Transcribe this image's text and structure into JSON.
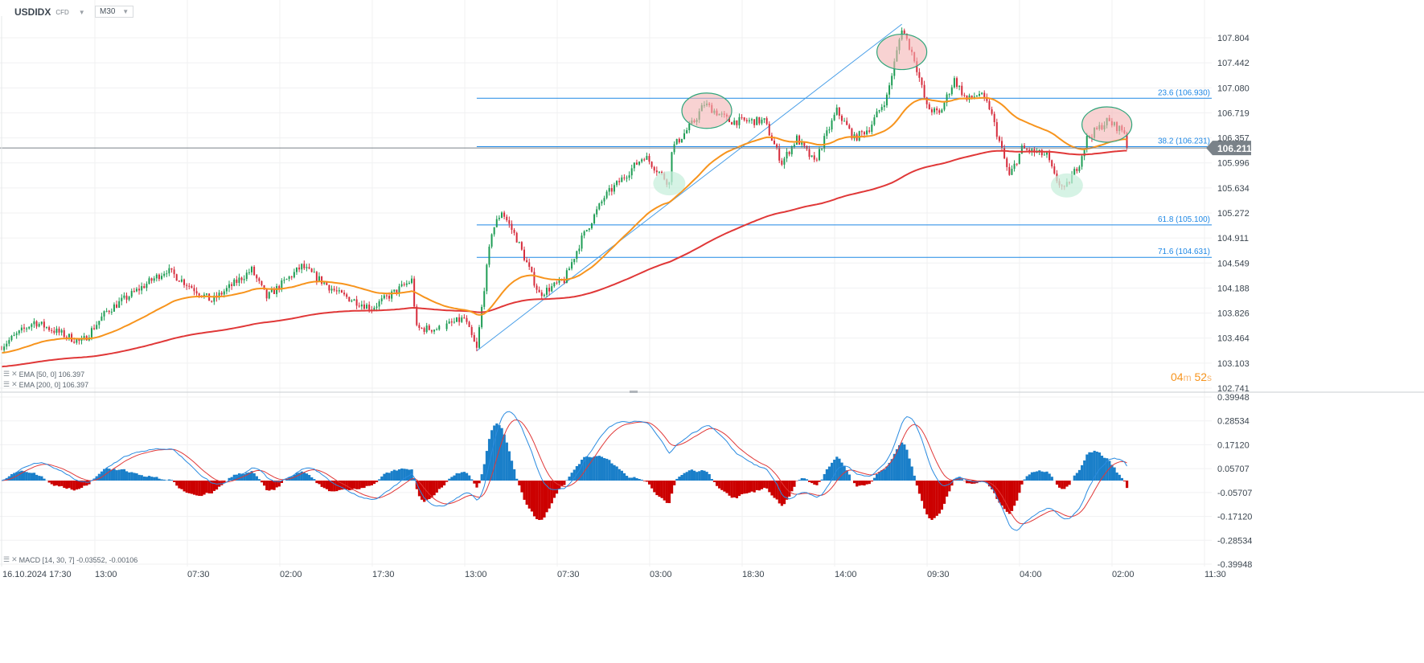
{
  "header": {
    "symbol": "USDIDX",
    "instrument_type": "CFD",
    "timeframe": "M30"
  },
  "indicators": {
    "ema50": {
      "label": "EMA [50, 0] 106.397",
      "color": "#f7941d"
    },
    "ema200": {
      "label": "EMA [200, 0] 106.397",
      "color": "#e03838"
    },
    "macd": {
      "label": "MACD [14, 30, 7] -0.03552, -0.00106"
    }
  },
  "countdown": {
    "minutes": "04",
    "m": "m",
    "seconds": "52",
    "s": "s"
  },
  "chart_data": {
    "type": "candlestick",
    "title": "USDIDX M30",
    "price_axis": {
      "ticks": [
        "107.804",
        "107.442",
        "107.080",
        "106.719",
        "106.357",
        "105.996",
        "105.634",
        "105.272",
        "104.911",
        "104.549",
        "104.188",
        "103.826",
        "103.464",
        "103.103",
        "102.741"
      ],
      "ylim": [
        102.741,
        107.804
      ]
    },
    "macd_axis": {
      "ticks": [
        "0.39948",
        "0.28534",
        "0.17120",
        "0.05707",
        "-0.05707",
        "-0.17120",
        "-0.28534",
        "-0.39948"
      ],
      "ylim": [
        -0.39948,
        0.39948
      ]
    },
    "x_ticks": [
      "16.10.2024  17:30",
      "13:00",
      "07:30",
      "02:00",
      "17:30",
      "13:00",
      "07:30",
      "03:00",
      "18:30",
      "14:00",
      "09:30",
      "04:00",
      "02:00",
      "11:30"
    ],
    "current_price": {
      "label": "106.211",
      "value": 106.211
    },
    "price_path_bars_vs_price": [
      [
        0,
        103.35
      ],
      [
        13,
        103.7
      ],
      [
        32,
        103.4
      ],
      [
        42,
        103.85
      ],
      [
        66,
        104.45
      ],
      [
        84,
        104.0
      ],
      [
        100,
        104.45
      ],
      [
        106,
        104.05
      ],
      [
        120,
        104.5
      ],
      [
        135,
        104.1
      ],
      [
        148,
        103.9
      ],
      [
        164,
        104.3
      ],
      [
        166,
        103.6
      ],
      [
        175,
        103.6
      ],
      [
        185,
        103.75
      ],
      [
        190,
        103.3
      ],
      [
        193,
        104.2
      ],
      [
        196,
        105.0
      ],
      [
        200,
        105.3
      ],
      [
        206,
        104.9
      ],
      [
        215,
        104.1
      ],
      [
        225,
        104.3
      ],
      [
        232,
        104.9
      ],
      [
        241,
        105.5
      ],
      [
        257,
        106.1
      ],
      [
        267,
        105.7
      ],
      [
        268,
        106.2
      ],
      [
        277,
        106.6
      ],
      [
        281,
        106.85
      ],
      [
        291,
        106.6
      ],
      [
        305,
        106.6
      ],
      [
        312,
        106.0
      ],
      [
        318,
        106.35
      ],
      [
        325,
        106.0
      ],
      [
        334,
        106.75
      ],
      [
        341,
        106.35
      ],
      [
        347,
        106.5
      ],
      [
        354,
        106.95
      ],
      [
        358,
        107.6
      ],
      [
        360,
        107.95
      ],
      [
        365,
        107.5
      ],
      [
        370,
        106.8
      ],
      [
        375,
        106.7
      ],
      [
        381,
        107.2
      ],
      [
        386,
        106.9
      ],
      [
        391,
        107.0
      ],
      [
        395,
        106.8
      ],
      [
        403,
        105.8
      ],
      [
        408,
        106.2
      ],
      [
        418,
        106.1
      ],
      [
        421,
        105.8
      ],
      [
        425,
        105.6
      ],
      [
        431,
        106.0
      ],
      [
        434,
        106.35
      ],
      [
        442,
        106.6
      ],
      [
        449,
        106.45
      ],
      [
        450,
        106.21
      ]
    ],
    "fibonacci": [
      {
        "label": "23.6 (106.930)",
        "value": 106.93
      },
      {
        "label": "38.2 (106.231)",
        "value": 106.231
      },
      {
        "label": "61.8 (105.100)",
        "value": 105.1
      },
      {
        "label": "71.6 (104.631)",
        "value": 104.631
      }
    ],
    "fib_start_bar": 190,
    "trendline": {
      "from": [
        190,
        103.28
      ],
      "to": [
        360,
        108.0
      ]
    },
    "annotations": [
      {
        "type": "resistance-circle",
        "bar": 360,
        "price": 107.6,
        "color": "#f4b4b4"
      },
      {
        "type": "resistance-circle",
        "bar": 282,
        "price": 106.75,
        "color": "#f4b4b4"
      },
      {
        "type": "resistance-circle",
        "bar": 442,
        "price": 106.55,
        "color": "#f4b4b4"
      },
      {
        "type": "support-circle",
        "bar": 267,
        "price": 105.7,
        "color": "#c8efdc"
      },
      {
        "type": "support-circle",
        "bar": 426,
        "price": 105.67,
        "color": "#c8efdc"
      }
    ],
    "colors": {
      "up": "#1f9d55",
      "down": "#d62c3c",
      "fib": "#1e88e5",
      "macd_pos": "#1a7fc9",
      "macd_neg": "#cc0000",
      "price_label_bg": "#7a8289"
    }
  }
}
